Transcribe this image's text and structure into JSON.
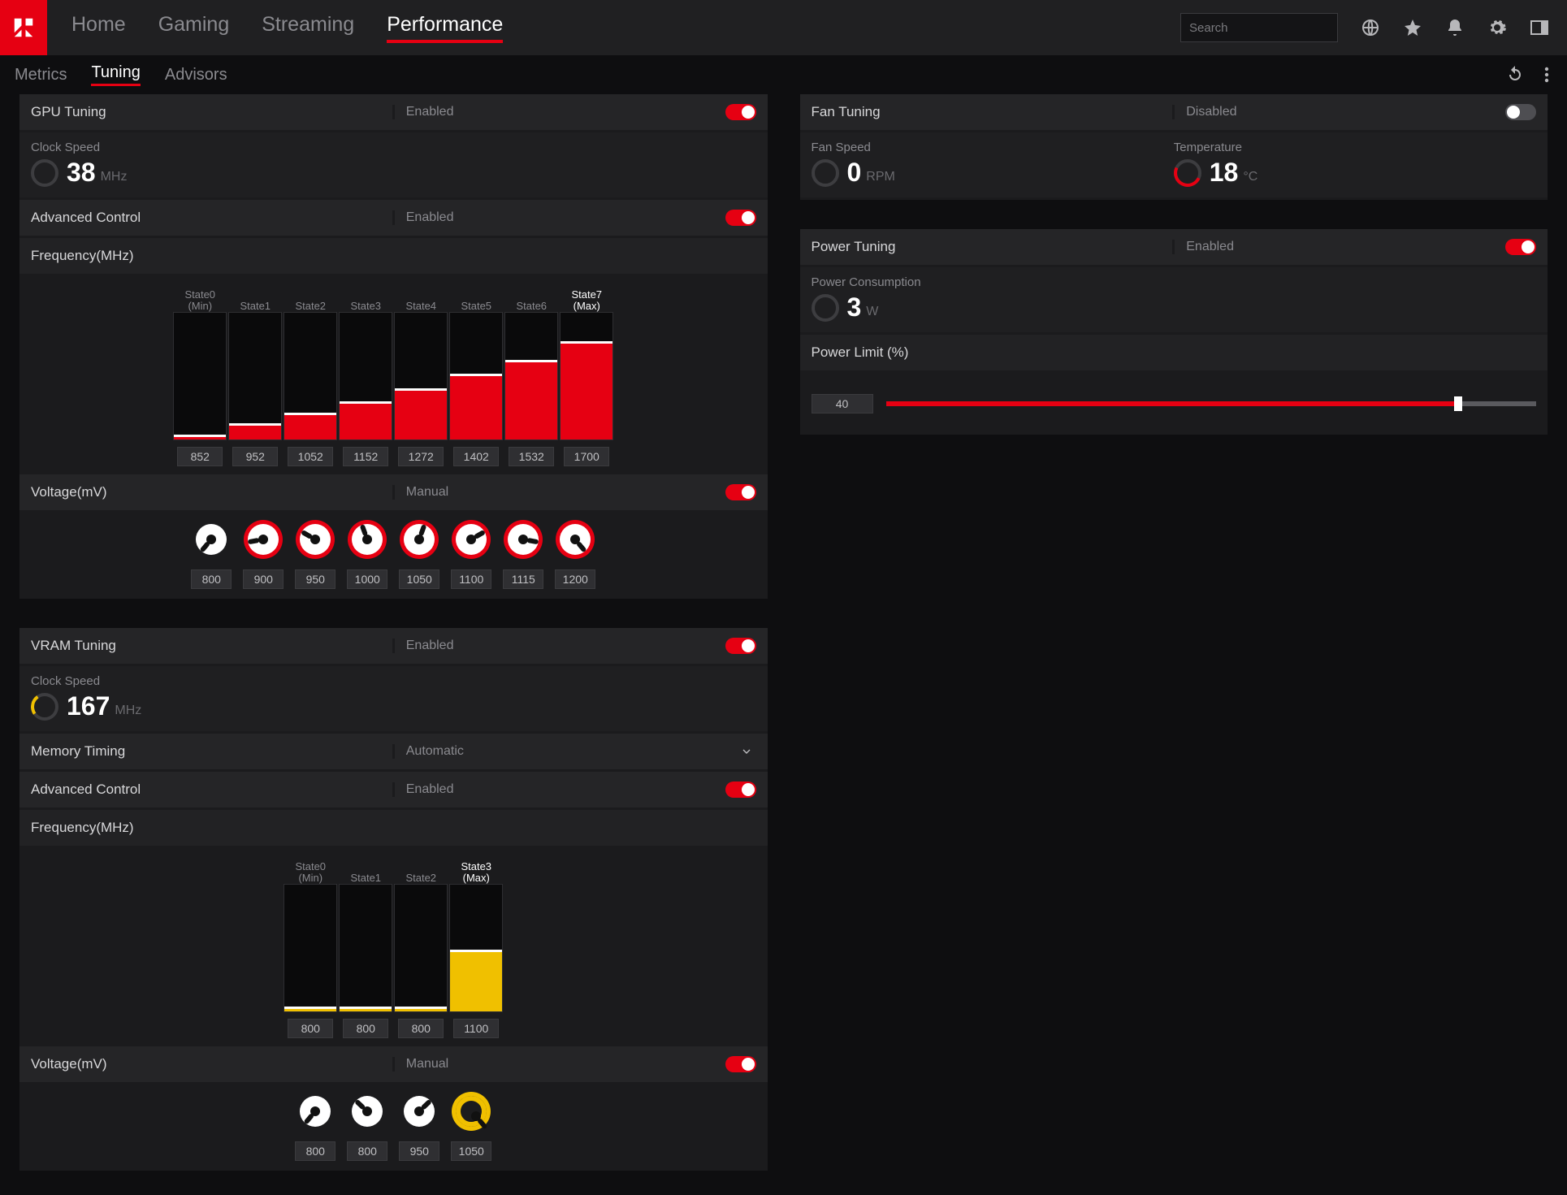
{
  "colors": {
    "accent": "#e60012",
    "accent2": "#f0c000"
  },
  "topnav": {
    "items": [
      {
        "label": "Home"
      },
      {
        "label": "Gaming"
      },
      {
        "label": "Streaming"
      },
      {
        "label": "Performance"
      }
    ],
    "active_index": 3
  },
  "search": {
    "placeholder": "Search"
  },
  "subtabs": {
    "items": [
      {
        "label": "Metrics"
      },
      {
        "label": "Tuning"
      },
      {
        "label": "Advisors"
      }
    ],
    "active_index": 1
  },
  "gpu_tuning": {
    "title": "GPU Tuning",
    "status": "Enabled",
    "enabled": true,
    "clock": {
      "label": "Clock Speed",
      "value": "38",
      "unit": "MHz"
    },
    "advanced": {
      "label": "Advanced Control",
      "status": "Enabled",
      "enabled": true
    },
    "freq_label": "Frequency(MHz)",
    "max_height": 1700,
    "states": [
      {
        "head": "State0\n(Min)",
        "value": "852"
      },
      {
        "head": "State1",
        "value": "952"
      },
      {
        "head": "State2",
        "value": "1052"
      },
      {
        "head": "State3",
        "value": "1152"
      },
      {
        "head": "State4",
        "value": "1272"
      },
      {
        "head": "State5",
        "value": "1402"
      },
      {
        "head": "State6",
        "value": "1532"
      },
      {
        "head": "State7\n(Max)",
        "value": "1700"
      }
    ],
    "voltage": {
      "label": "Voltage(mV)",
      "mode": "Manual",
      "enabled": true,
      "values": [
        "800",
        "900",
        "950",
        "1000",
        "1050",
        "1100",
        "1115",
        "1200"
      ]
    }
  },
  "vram_tuning": {
    "title": "VRAM Tuning",
    "status": "Enabled",
    "enabled": true,
    "clock": {
      "label": "Clock Speed",
      "value": "167",
      "unit": "MHz"
    },
    "memory_timing": {
      "label": "Memory Timing",
      "mode": "Automatic"
    },
    "advanced": {
      "label": "Advanced Control",
      "status": "Enabled",
      "enabled": true
    },
    "freq_label": "Frequency(MHz)",
    "max_height": 1100,
    "states": [
      {
        "head": "State0\n(Min)",
        "value": "800"
      },
      {
        "head": "State1",
        "value": "800"
      },
      {
        "head": "State2",
        "value": "800"
      },
      {
        "head": "State3\n(Max)",
        "value": "1100"
      }
    ],
    "voltage": {
      "label": "Voltage(mV)",
      "mode": "Manual",
      "enabled": true,
      "values": [
        "800",
        "800",
        "950",
        "1050"
      ]
    }
  },
  "fan_tuning": {
    "title": "Fan Tuning",
    "status": "Disabled",
    "enabled": false,
    "fan": {
      "label": "Fan Speed",
      "value": "0",
      "unit": "RPM"
    },
    "temp": {
      "label": "Temperature",
      "value": "18",
      "unit": "°C"
    }
  },
  "power_tuning": {
    "title": "Power Tuning",
    "status": "Enabled",
    "enabled": true,
    "consumption": {
      "label": "Power Consumption",
      "value": "3",
      "unit": "W"
    },
    "limit_label": "Power Limit (%)",
    "limit_value": "40",
    "limit_fill_pct": 88
  },
  "chart_data": [
    {
      "type": "bar",
      "title": "GPU Frequency (MHz) by State",
      "categories": [
        "State0 (Min)",
        "State1",
        "State2",
        "State3",
        "State4",
        "State5",
        "State6",
        "State7 (Max)"
      ],
      "values": [
        852,
        952,
        1052,
        1152,
        1272,
        1402,
        1532,
        1700
      ],
      "ylabel": "Frequency (MHz)",
      "ylim": [
        0,
        1700
      ]
    },
    {
      "type": "bar",
      "title": "VRAM Frequency (MHz) by State",
      "categories": [
        "State0 (Min)",
        "State1",
        "State2",
        "State3 (Max)"
      ],
      "values": [
        800,
        800,
        800,
        1100
      ],
      "ylabel": "Frequency (MHz)",
      "ylim": [
        0,
        1100
      ]
    }
  ]
}
